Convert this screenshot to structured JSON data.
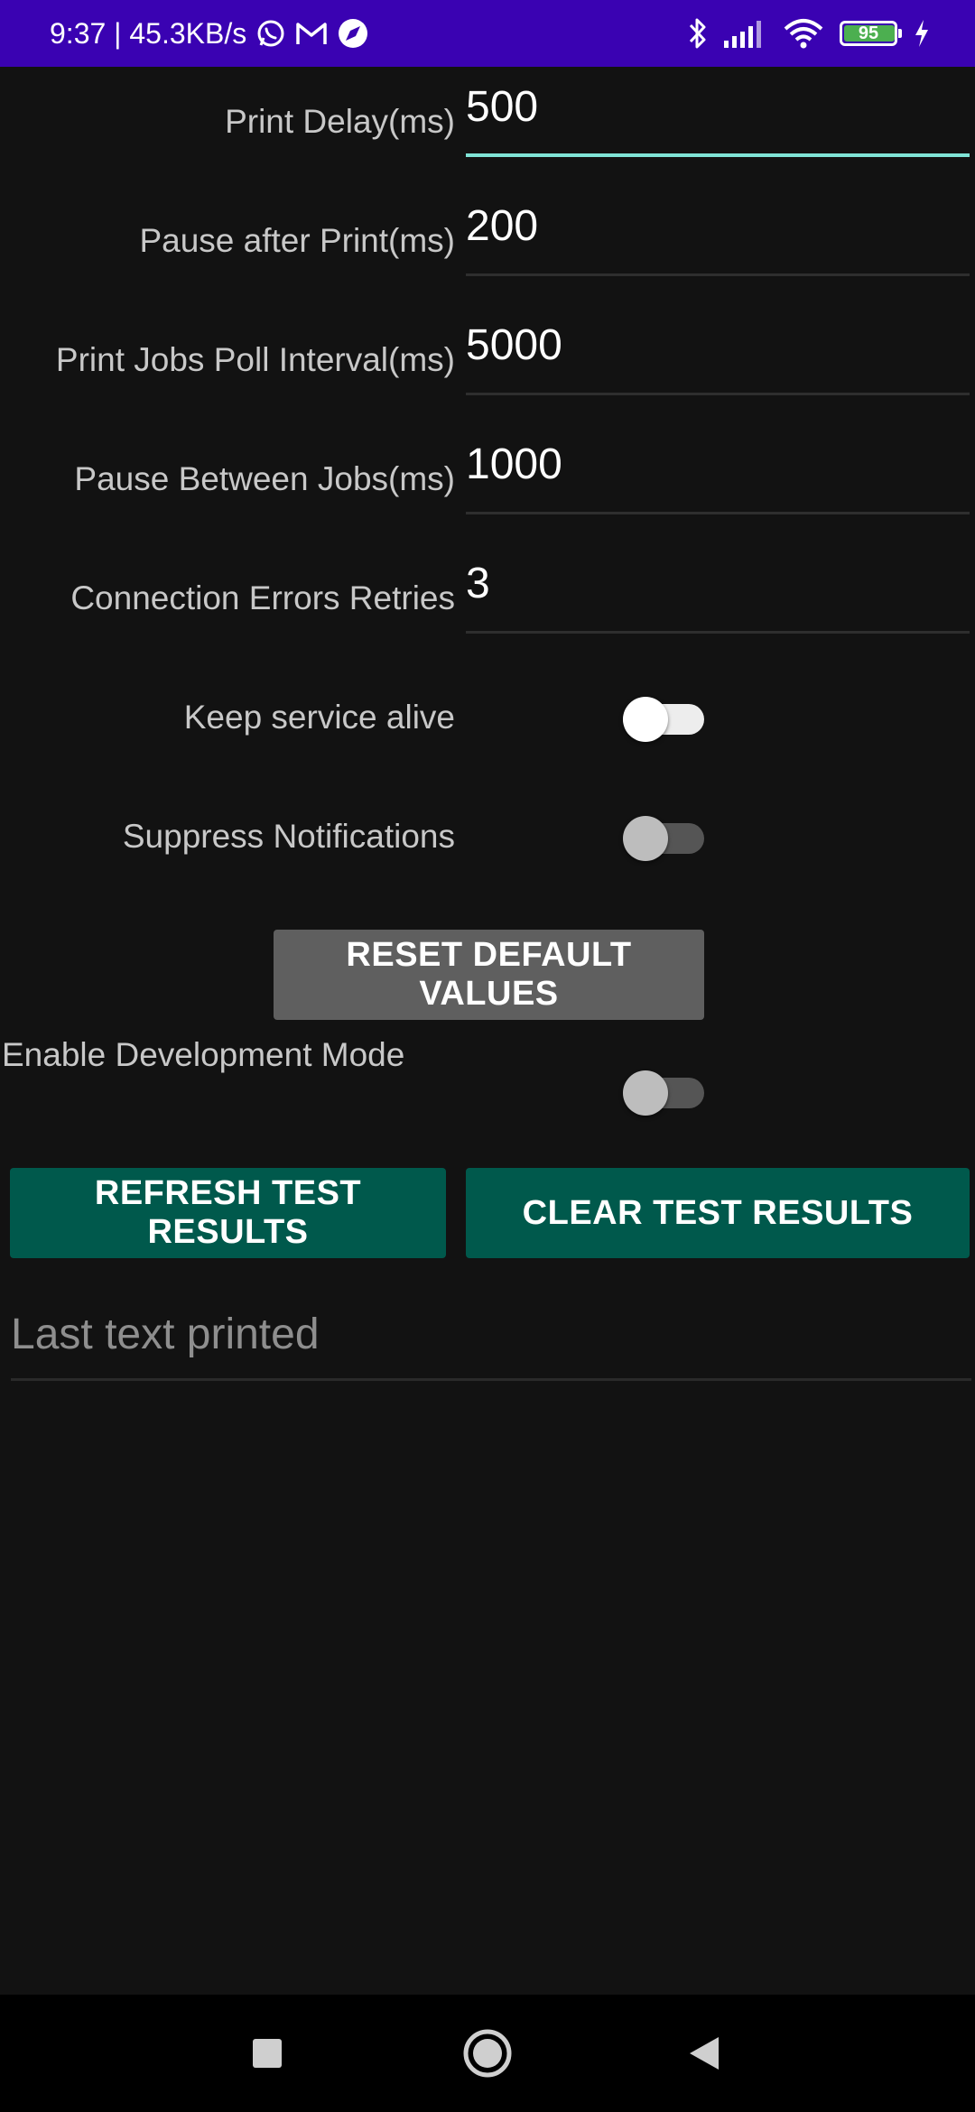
{
  "status_bar": {
    "time_speed": "9:37 | 45.3KB/s",
    "battery_level": "95",
    "icons": [
      "whatsapp-icon",
      "gmail-icon",
      "compass-icon",
      "bluetooth-icon",
      "signal-icon",
      "wifi-icon",
      "battery-icon",
      "charging-icon"
    ]
  },
  "settings": {
    "print_delay": {
      "label": "Print Delay(ms)",
      "value": "500"
    },
    "pause_after_print": {
      "label": "Pause after Print(ms)",
      "value": "200"
    },
    "poll_interval": {
      "label": "Print Jobs Poll Interval(ms)",
      "value": "5000"
    },
    "pause_between_jobs": {
      "label": "Pause Between Jobs(ms)",
      "value": "1000"
    },
    "connection_retries": {
      "label": "Connection Errors Retries",
      "value": "3"
    },
    "keep_alive": {
      "label": "Keep service alive",
      "on": false
    },
    "suppress_notifications": {
      "label": "Suppress Notifications",
      "on": false
    }
  },
  "reset_button": "RESET DEFAULT VALUES",
  "dev_mode": {
    "label": "Enable Development Mode",
    "on": false
  },
  "refresh_button": "REFRESH TEST RESULTS",
  "clear_button": "CLEAR TEST RESULTS",
  "last_text": {
    "placeholder": "Last text printed",
    "value": ""
  },
  "colors": {
    "status_bar": "#3A02B2",
    "background": "#121212",
    "accent_teal": "#00594C",
    "focus_underline": "#7FE3D5"
  }
}
